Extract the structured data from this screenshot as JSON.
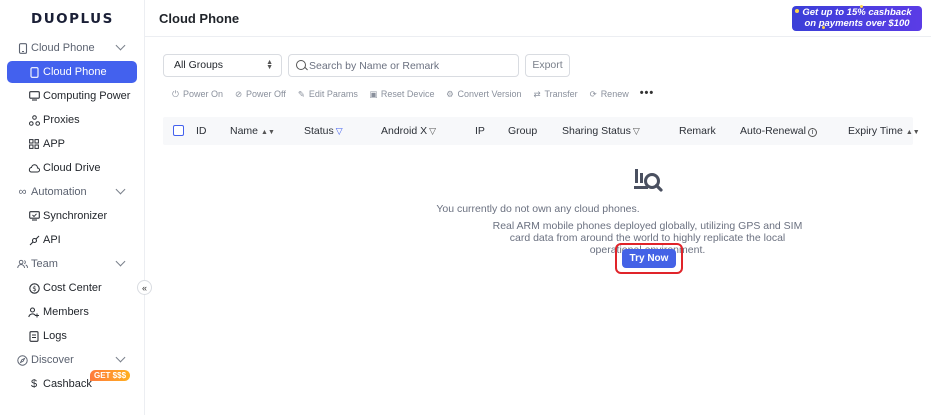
{
  "app": {
    "logo": "DUOPLUS"
  },
  "header": {
    "title": "Cloud Phone",
    "promo_line1": "Get up to 15% cashback",
    "promo_line2": "on payments over $100"
  },
  "sidebar": {
    "groups": [
      {
        "label": "Cloud Phone",
        "icon": "phone-outline-icon"
      },
      {
        "label": "Automation",
        "icon": "infinity-icon"
      },
      {
        "label": "Team",
        "icon": "users-icon"
      },
      {
        "label": "Discover",
        "icon": "compass-icon"
      }
    ],
    "items": [
      {
        "label": "Cloud Phone",
        "icon": "phone-icon",
        "active": true
      },
      {
        "label": "Computing Power",
        "icon": "monitor-icon"
      },
      {
        "label": "Proxies",
        "icon": "network-icon"
      },
      {
        "label": "APP",
        "icon": "grid-icon"
      },
      {
        "label": "Cloud Drive",
        "icon": "cloud-icon"
      },
      {
        "label": "Synchronizer",
        "icon": "sync-screen-icon"
      },
      {
        "label": "API",
        "icon": "api-icon"
      },
      {
        "label": "Cost Center",
        "icon": "dollar-circle-icon"
      },
      {
        "label": "Members",
        "icon": "user-plus-icon"
      },
      {
        "label": "Logs",
        "icon": "document-icon"
      },
      {
        "label": "Cashback",
        "icon": "dollar-icon",
        "badge": "GET $$$"
      }
    ],
    "collapse_glyph": "«"
  },
  "filters": {
    "group_select": "All Groups",
    "search_placeholder": "Search by Name or Remark",
    "export_label": "Export"
  },
  "toolbar": {
    "actions": [
      {
        "label": "Power On",
        "icon": "power-icon"
      },
      {
        "label": "Power Off",
        "icon": "power-off-icon"
      },
      {
        "label": "Edit Params",
        "icon": "edit-icon"
      },
      {
        "label": "Reset Device",
        "icon": "reset-icon"
      },
      {
        "label": "Convert Version",
        "icon": "convert-icon"
      },
      {
        "label": "Transfer",
        "icon": "transfer-icon"
      },
      {
        "label": "Renew",
        "icon": "renew-icon"
      }
    ],
    "more": "•••"
  },
  "table": {
    "columns": [
      "ID",
      "Name",
      "Status",
      "Android X",
      "IP",
      "Group",
      "Sharing Status",
      "Remark",
      "Auto-Renewal",
      "Expiry Time"
    ]
  },
  "empty_state": {
    "title": "You currently do not own any cloud phones.",
    "description": "Real ARM mobile phones deployed globally, utilizing GPS and SIM card data from around the world to highly replicate the local operational environment.",
    "cta": "Try Now"
  },
  "colors": {
    "accent": "#4462e6",
    "highlight_border": "#e0242a",
    "promo_bg": "#4a3fe0",
    "badge": "#ff8a2a"
  }
}
